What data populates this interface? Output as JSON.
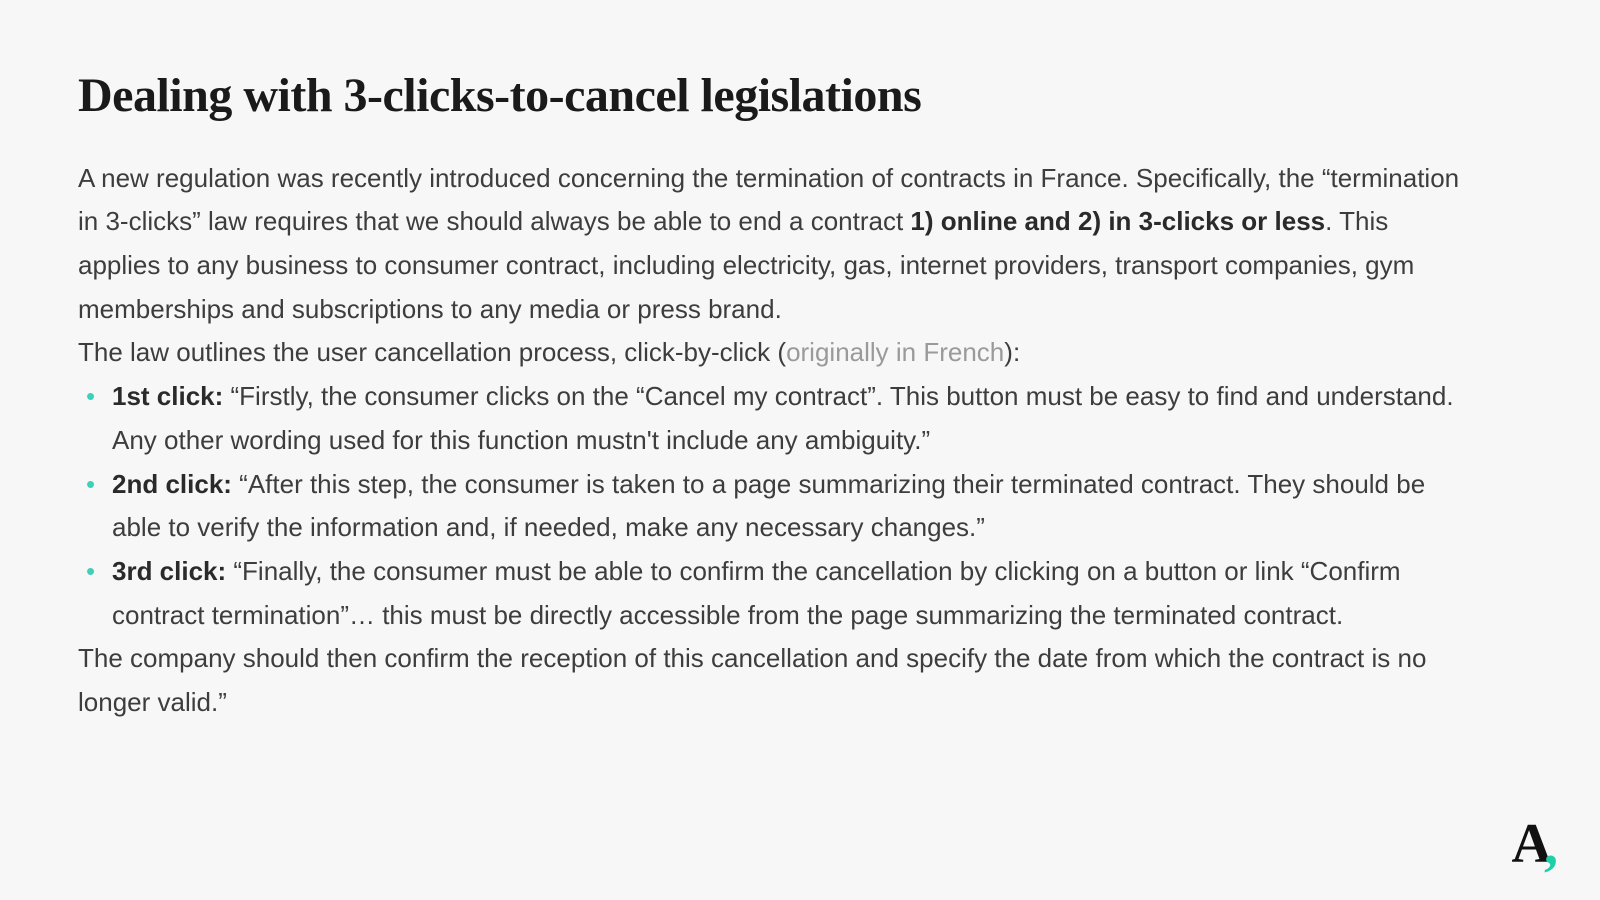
{
  "title": "Dealing with 3-clicks-to-cancel legislations",
  "intro": {
    "seg1": "A new regulation was recently introduced concerning the termination of contracts in France. Specifically, the “termination in 3-clicks” law requires that we should always be able to end a contract ",
    "bold1": "1) online and 2) in 3-clicks or less",
    "seg2": ". This applies to any business to consumer contract, including electricity, gas, internet providers, transport companies, gym memberships and subscriptions to any media or press brand."
  },
  "lead": {
    "seg1": "The law outlines the user cancellation process, click-by-click (",
    "link": "originally in French",
    "seg2": "):"
  },
  "clicks": [
    {
      "label": "1st click:",
      "text": " “Firstly, the consumer clicks on the “Cancel my contract”. This button must be easy to find and understand. Any other wording used for this function mustn't include any ambiguity.”"
    },
    {
      "label": "2nd click:",
      "text": " “After this step, the consumer is taken to a page summarizing their terminated contract. They should be able to verify the information and, if needed, make any necessary changes.”"
    },
    {
      "label": "3rd click:",
      "text": " “Finally, the consumer must be able to confirm the cancellation by clicking on a button or link “Confirm contract termination”… this must be directly accessible from the page summarizing the terminated contract."
    }
  ],
  "outro": "The company should then confirm the reception of this cancellation and specify the date from which the contract is no longer valid.”",
  "logo": {
    "letter": "A",
    "comma": ","
  }
}
